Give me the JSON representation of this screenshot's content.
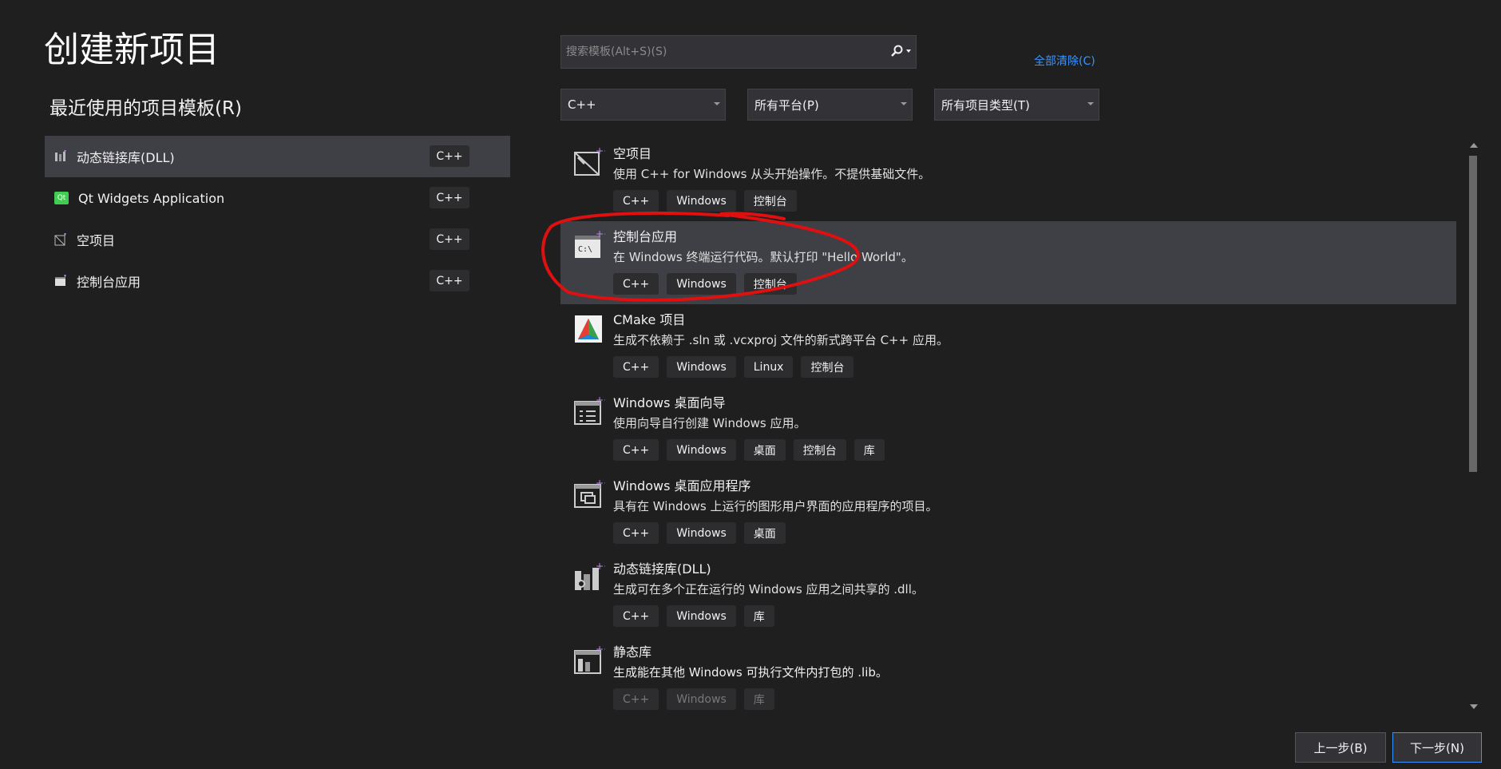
{
  "page": {
    "title": "创建新项目"
  },
  "recent": {
    "heading": "最近使用的项目模板(R)",
    "items": [
      {
        "label": "动态链接库(DLL)",
        "lang": "C++",
        "icon": "dll-icon"
      },
      {
        "label": "Qt Widgets Application",
        "lang": "C++",
        "icon": "qt-icon",
        "icon_text": "Qt"
      },
      {
        "label": "空项目",
        "lang": "C++",
        "icon": "empty-project-icon"
      },
      {
        "label": "控制台应用",
        "lang": "C++",
        "icon": "console-app-icon"
      }
    ]
  },
  "search": {
    "placeholder": "搜索模板(Alt+S)(S)",
    "icon": "search-icon"
  },
  "filters": {
    "clear_all": "全部清除(C)",
    "language": "C++",
    "platform": "所有平台(P)",
    "project_type": "所有项目类型(T)"
  },
  "templates": [
    {
      "name": "空项目",
      "desc": "使用 C++ for Windows 从头开始操作。不提供基础文件。",
      "tags": [
        "C++",
        "Windows",
        "控制台"
      ],
      "icon": "empty-project-icon"
    },
    {
      "name": "控制台应用",
      "desc": "在 Windows 终端运行代码。默认打印 \"Hello World\"。",
      "tags": [
        "C++",
        "Windows",
        "控制台"
      ],
      "icon": "console-app-icon"
    },
    {
      "name": "CMake 项目",
      "desc": "生成不依赖于 .sln 或 .vcxproj 文件的新式跨平台 C++ 应用。",
      "tags": [
        "C++",
        "Windows",
        "Linux",
        "控制台"
      ],
      "icon": "cmake-icon"
    },
    {
      "name": "Windows 桌面向导",
      "desc": "使用向导自行创建 Windows 应用。",
      "tags": [
        "C++",
        "Windows",
        "桌面",
        "控制台",
        "库"
      ],
      "icon": "wizard-icon"
    },
    {
      "name": "Windows 桌面应用程序",
      "desc": "具有在 Windows 上运行的图形用户界面的应用程序的项目。",
      "tags": [
        "C++",
        "Windows",
        "桌面"
      ],
      "icon": "desktop-app-icon"
    },
    {
      "name": "动态链接库(DLL)",
      "desc": "生成可在多个正在运行的 Windows 应用之间共享的 .dll。",
      "tags": [
        "C++",
        "Windows",
        "库"
      ],
      "icon": "dll-icon"
    },
    {
      "name": "静态库",
      "desc": "生成能在其他 Windows 可执行文件内打包的 .lib。",
      "tags": [
        "C++",
        "Windows",
        "库"
      ],
      "icon": "static-lib-icon"
    }
  ],
  "buttons": {
    "back": "上一步(B)",
    "next": "下一步(N)"
  },
  "colors": {
    "background": "#1f1f1f",
    "selected": "#3f3f46",
    "accent_link": "#3794ff",
    "icon_purple": "#c586f0",
    "annotation": "#e01010"
  }
}
